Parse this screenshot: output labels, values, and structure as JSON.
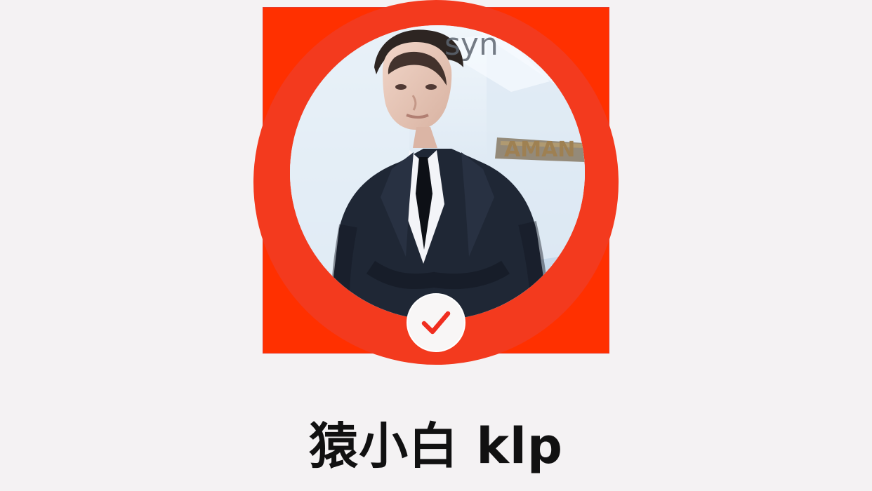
{
  "profile": {
    "username": "猿小白 klp",
    "verified": true
  },
  "colors": {
    "accent_red": "#ff3000",
    "badge_bg": "#f8f6f6",
    "background": "#f4f2f3"
  },
  "icons": {
    "verified": "checkmark-icon"
  }
}
